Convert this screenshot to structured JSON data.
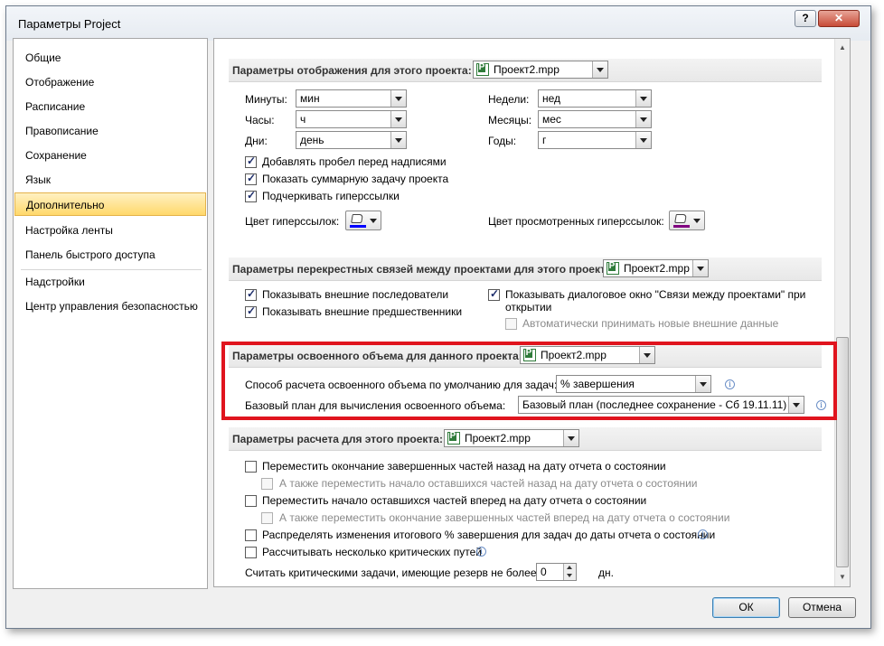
{
  "window": {
    "title": "Параметры Project",
    "help_glyph": "?",
    "close_glyph": "✕"
  },
  "sidebar": {
    "items": [
      {
        "label": "Общие"
      },
      {
        "label": "Отображение"
      },
      {
        "label": "Расписание"
      },
      {
        "label": "Правописание"
      },
      {
        "label": "Сохранение"
      },
      {
        "label": "Язык"
      },
      {
        "label": "Дополнительно"
      },
      {
        "label": "Настройка ленты"
      },
      {
        "label": "Панель быстрого доступа"
      },
      {
        "label": "Надстройки"
      },
      {
        "label": "Центр управления безопасностью"
      }
    ],
    "selected": "Дополнительно"
  },
  "display_section": {
    "title": "Параметры отображения для этого проекта:",
    "project": "Проект2.mpp",
    "minutes_label": "Минуты:",
    "minutes_value": "мин",
    "hours_label": "Часы:",
    "hours_value": "ч",
    "days_label": "Дни:",
    "days_value": "день",
    "weeks_label": "Недели:",
    "weeks_value": "нед",
    "months_label": "Месяцы:",
    "months_value": "мес",
    "years_label": "Годы:",
    "years_value": "г",
    "cb_space": "Добавлять пробел перед надписями",
    "cb_summary": "Показать суммарную задачу проекта",
    "cb_underline": "Подчеркивать гиперссылки",
    "hyperlink_color_label": "Цвет гиперссылок:",
    "visited_color_label": "Цвет просмотренных гиперссылок:",
    "hyperlink_color": "#0000ff",
    "visited_color": "#800080"
  },
  "cross_section": {
    "title": "Параметры перекрестных связей между проектами для этого проекта:",
    "project": "Проект2.mpp",
    "cb_successors": "Показывать внешние последователи",
    "cb_predecessors": "Показывать внешние предшественники",
    "cb_dialog_line1": "Показывать диалоговое окно \"Связи между проектами\" при",
    "cb_dialog_line2": "открытии",
    "cb_auto_accept": "Автоматически принимать новые внешние данные"
  },
  "earned_section": {
    "title": "Параметры освоенного объема для данного проекта:",
    "project": "Проект2.mpp",
    "method_label": "Способ расчета освоенного объема по умолчанию для задач:",
    "method_value": "% завершения",
    "baseline_label": "Базовый план для вычисления освоенного объема:",
    "baseline_value": "Базовый план  (последнее сохранение - Сб 19.11.11)",
    "highlight_color": "#e0141e"
  },
  "calc_section": {
    "title": "Параметры расчета для этого проекта:",
    "project": "Проект2.mpp",
    "cb_move_end_back": "Переместить окончание завершенных частей назад на дату отчета о состоянии",
    "cb_move_start_back": "А также переместить начало оставшихся частей назад на дату отчета о состоянии",
    "cb_move_start_fwd": "Переместить начало оставшихся частей вперед на дату отчета о состоянии",
    "cb_move_end_fwd": "А также переместить окончание завершенных частей вперед на дату отчета о состоянии",
    "cb_spread": "Распределять изменения итогового % завершения для задач до даты отчета о состоянии",
    "cb_multi_critical": "Рассчитывать несколько критических путей",
    "slack_label": "Считать критическими задачи, имеющие резерв не более",
    "slack_value": "0",
    "slack_unit": "дн."
  },
  "buttons": {
    "ok": "ОК",
    "cancel": "Отмена"
  }
}
